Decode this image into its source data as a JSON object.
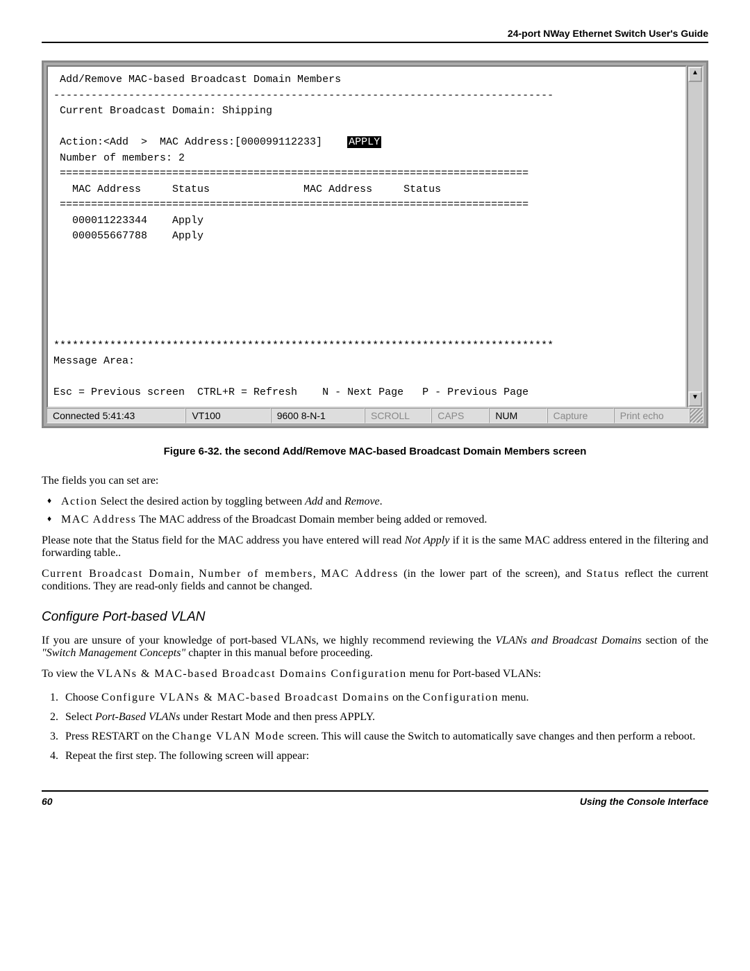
{
  "header": {
    "title": "24-port NWay Ethernet Switch User's Guide"
  },
  "terminal": {
    "l1": " Add/Remove MAC-based Broadcast Domain Members",
    "l2": "--------------------------------------------------------------------------------",
    "l3": " Current Broadcast Domain: Shipping",
    "l4a": " Action:<Add  >  MAC Address:[000099112233]    ",
    "l4_apply": "APPLY",
    "l5": " Number of members: 2",
    "l6": " ===========================================================================",
    "l7": "   MAC Address     Status               MAC Address     Status",
    "l8": " ===========================================================================",
    "l9": "   000011223344    Apply",
    "l10": "   000055667788    Apply",
    "stars": "********************************************************************************",
    "msg": "Message Area:",
    "help": "Esc = Previous screen  CTRL+R = Refresh    N - Next Page   P - Previous Page"
  },
  "statusbar": {
    "connected": "Connected 5:41:43",
    "term": "VT100",
    "comm": "9600 8-N-1",
    "scroll": "SCROLL",
    "caps": "CAPS",
    "num": "NUM",
    "capture": "Capture",
    "print": "Print echo"
  },
  "caption": "Figure 6-32.  the second Add/Remove MAC-based Broadcast Domain Members screen",
  "body": {
    "intro": "The fields you can set are:",
    "bullet1a": "Action",
    "bullet1b": "  Select the desired action by toggling between ",
    "bullet1c": "Add",
    "bullet1d": " and ",
    "bullet1e": "Remove",
    "bullet1f": ".",
    "bullet2a": "MAC Address",
    "bullet2b": "  The MAC address of the Broadcast Domain member being added or removed.",
    "para2a": "Please note that the Status field for the MAC address you have entered will read ",
    "para2b": "Not Apply",
    "para2c": " if it is the same MAC address entered in the filtering and forwarding table..",
    "para3a": "Current Broadcast Domain",
    "para3b": ", ",
    "para3c": "Number of members",
    "para3d": ", ",
    "para3e": "MAC Address",
    "para3f": " (in the lower part of the screen), and ",
    "para3g": "Status",
    "para3h": " reflect the current conditions. They are read-only fields and cannot be changed.",
    "heading": "Configure Port-based VLAN",
    "para4a": "If you are unsure of your knowledge of port-based VLANs, we highly recommend reviewing the ",
    "para4b": "VLANs and Broadcast Domains",
    "para4c": " section of the ",
    "para4d": "\"Switch Management Concepts\"",
    "para4e": " chapter in this manual before proceeding.",
    "para5a": "To view the ",
    "para5b": "VLANs & MAC-based Broadcast Domains Configuration",
    "para5c": " menu for Port-based VLANs:",
    "step1a": "Choose ",
    "step1b": "Configure VLANs & MAC-based Broadcast Domains",
    "step1c": " on the ",
    "step1d": "Configuration",
    "step1e": " menu.",
    "step2a": "Select ",
    "step2b": "Port-Based VLANs",
    "step2c": " under Restart Mode and then press APPLY.",
    "step3a": "Press RESTART on the ",
    "step3b": "Change VLAN Mode",
    "step3c": " screen. This will cause the Switch to automatically save changes and then perform a reboot.",
    "step4": "Repeat the first step. The following screen will appear:"
  },
  "footer": {
    "page": "60",
    "section": "Using the Console Interface"
  }
}
